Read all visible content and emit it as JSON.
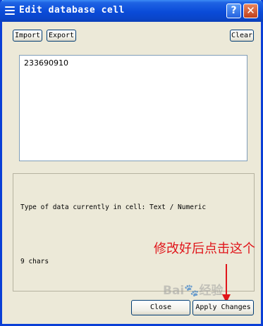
{
  "window": {
    "title": "Edit database cell",
    "title_icon": "menu-lines-icon",
    "help_glyph": "?",
    "close_glyph": "✕"
  },
  "toolbar": {
    "import_label": "Import",
    "export_label": "Export",
    "clear_label": "Clear"
  },
  "editor": {
    "value": "233690910"
  },
  "info": {
    "type_text": "Type of data currently in cell: Text / Numeric",
    "char_count": "9 chars"
  },
  "annotation": {
    "text": "修改好后点击这个",
    "color": "#e0151a"
  },
  "buttons": {
    "close_label": "Close",
    "apply_label": "Apply Changes"
  },
  "watermark": {
    "brand_left": "Bai",
    "brand_right": "经验",
    "paw_glyph": "🐾"
  },
  "colors": {
    "titlebar": "#0a4bd8",
    "window_bg": "#ece9d8",
    "button_border": "#003c74"
  }
}
